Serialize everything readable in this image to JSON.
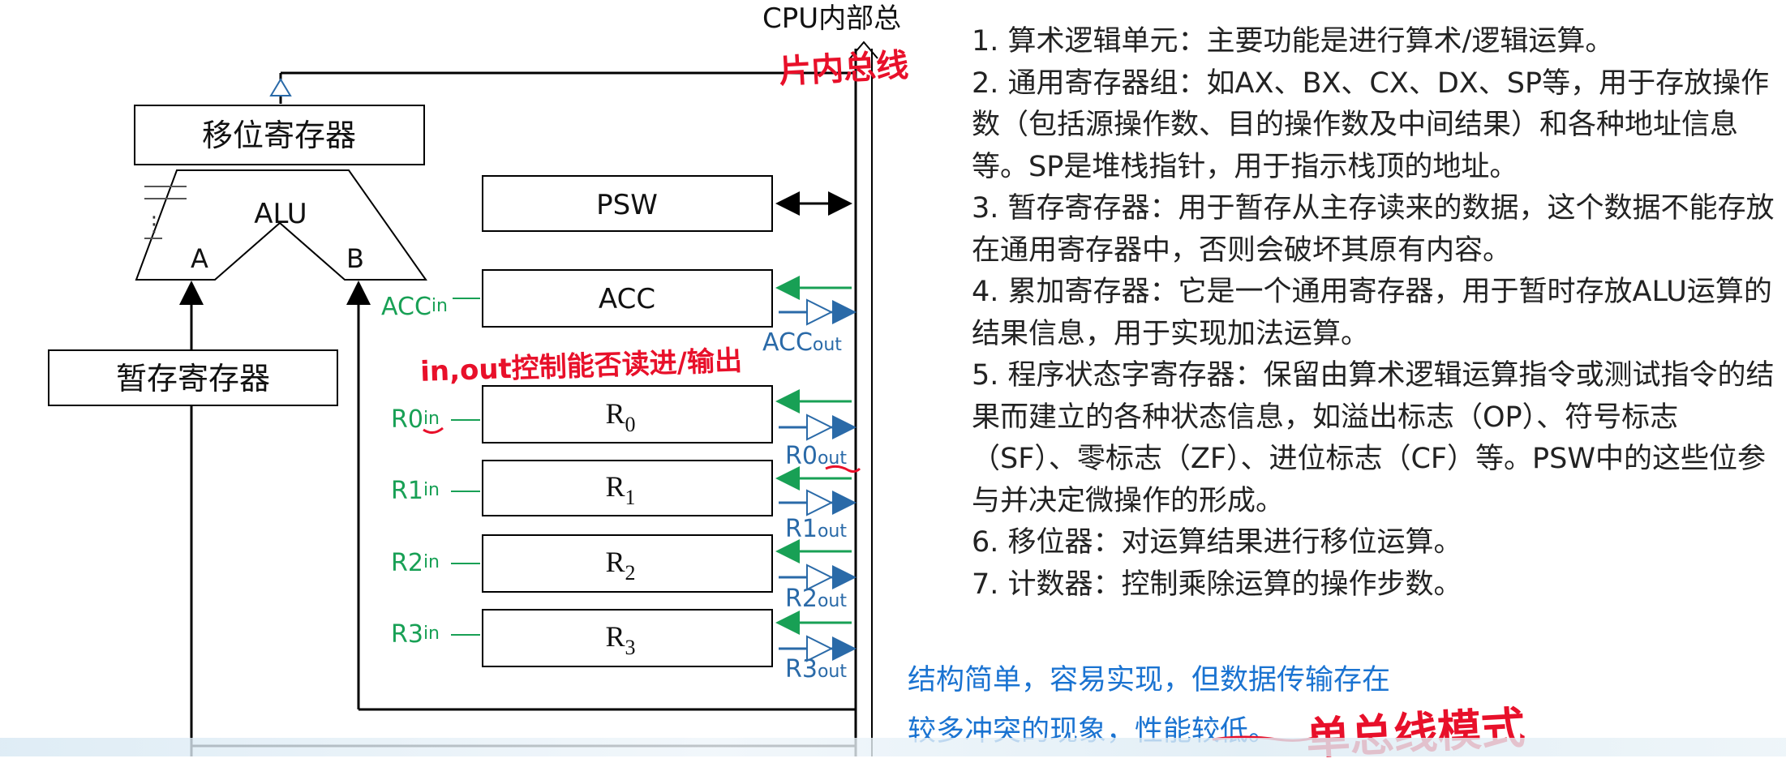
{
  "bus_label": "CPU内部总线",
  "registers": {
    "shift": "移位寄存器",
    "alu": "ALU",
    "alu_in_a": "A",
    "alu_in_b": "B",
    "temp": "暂存寄存器",
    "psw": "PSW",
    "acc": "ACC",
    "r0": "R",
    "r1": "R",
    "r2": "R",
    "r3": "R",
    "sub0": "0",
    "sub1": "1",
    "sub2": "2",
    "sub3": "3"
  },
  "signals": {
    "acc_in": "ACC",
    "acc_out": "ACC",
    "r0_in": "R0",
    "r0_out": "R0",
    "r1_in": "R1",
    "r1_out": "R1",
    "r2_in": "R2",
    "r2_out": "R2",
    "r3_in": "R3",
    "r3_out": "R3",
    "in_suffix": "in",
    "out_suffix": "out"
  },
  "notes": [
    "1. 算术逻辑单元：主要功能是进行算术/逻辑运算。",
    "2. 通用寄存器组：如AX、BX、CX、DX、SP等，用于存放操作数（包括源操作数、目的操作数及中间结果）和各种地址信息等。SP是堆栈指针，用于指示栈顶的地址。",
    "3. 暂存寄存器：用于暂存从主存读来的数据，这个数据不能存放在通用寄存器中，否则会破坏其原有内容。",
    "4. 累加寄存器：它是一个通用寄存器，用于暂时存放ALU运算的结果信息，用于实现加法运算。",
    "5. 程序状态字寄存器：保留由算术逻辑运算指令或测试指令的结果而建立的各种状态信息，如溢出标志（OP）、符号标志（SF）、零标志（ZF）、进位标志（CF）等。PSW中的这些位参与并决定微操作的形成。",
    "6. 移位器：对运算结果进行移位运算。",
    "7. 计数器：控制乘除运算的操作步数。"
  ],
  "summary": [
    "结构简单，容易实现，但数据传输存在",
    "较多冲突的现象，性能较低。"
  ],
  "handwritten": {
    "bus": "片内总线",
    "in_out": "in,out控制能否读进/输出",
    "mode": "单总线模式"
  },
  "colors": {
    "signal_green": "#18a055",
    "signal_blue": "#2a6aa8",
    "summary_blue": "#1a73d1",
    "handwriting_red": "#e8102a"
  }
}
